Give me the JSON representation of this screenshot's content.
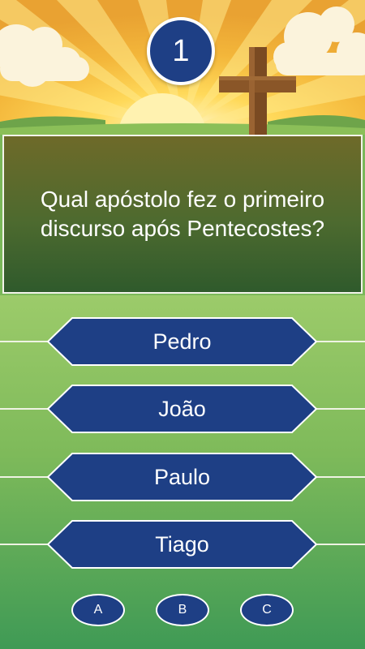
{
  "round": {
    "number": "1"
  },
  "question": {
    "text": "Qual apóstolo fez o primeiro discurso após Pentecostes?"
  },
  "answers": [
    {
      "label": "Pedro"
    },
    {
      "label": "João"
    },
    {
      "label": "Paulo"
    },
    {
      "label": "Tiago"
    }
  ],
  "lifelines": [
    {
      "label": "A"
    },
    {
      "label": "B"
    },
    {
      "label": "C"
    }
  ],
  "colors": {
    "badge": "#1e3f85",
    "answer_fill": "#1e3f85",
    "outline": "#ffffff"
  },
  "scene": {
    "icons": [
      "sun-icon",
      "cloud-icon",
      "cross-icon"
    ]
  }
}
